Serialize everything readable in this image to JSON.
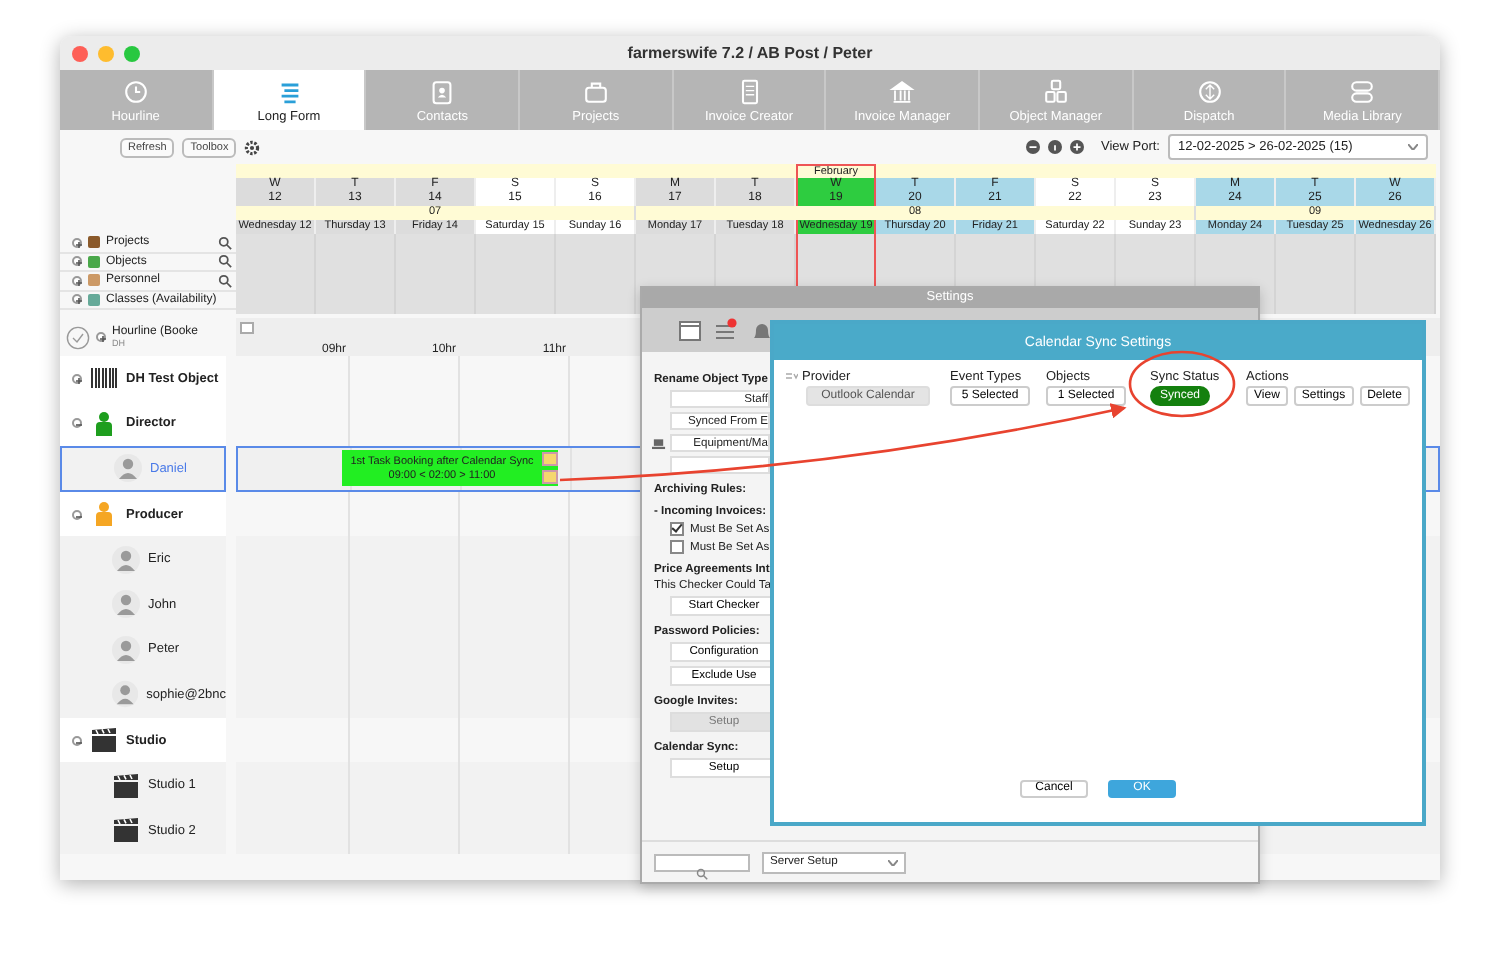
{
  "window": {
    "title": "farmerswife 7.2  / AB Post / Peter"
  },
  "tabs": [
    {
      "label": "Hourline",
      "selected": false
    },
    {
      "label": "Long Form",
      "selected": true
    },
    {
      "label": "Contacts",
      "selected": false
    },
    {
      "label": "Projects",
      "selected": false
    },
    {
      "label": "Invoice Creator",
      "selected": false
    },
    {
      "label": "Invoice Manager",
      "selected": false
    },
    {
      "label": "Object Manager",
      "selected": false
    },
    {
      "label": "Dispatch",
      "selected": false
    },
    {
      "label": "Media Library",
      "selected": false
    }
  ],
  "toolbar": {
    "refresh": "Refresh",
    "toolbox": "Toolbox",
    "view_port_label": "View Port:",
    "view_port": "12-02-2025 > 26-02-2025 (15)"
  },
  "calendar": {
    "days": [
      {
        "letter": "W",
        "number": "12",
        "name": "Wednesday 12",
        "kind": "past",
        "week": "07"
      },
      {
        "letter": "T",
        "number": "13",
        "name": "Thursday 13",
        "kind": "past"
      },
      {
        "letter": "F",
        "number": "14",
        "name": "Friday 14",
        "kind": "past"
      },
      {
        "letter": "S",
        "number": "15",
        "name": "Saturday 15",
        "kind": "weekend"
      },
      {
        "letter": "S",
        "number": "16",
        "name": "Sunday 16",
        "kind": "weekend"
      },
      {
        "letter": "M",
        "number": "17",
        "name": "Monday 17",
        "kind": "past",
        "week": "08"
      },
      {
        "letter": "T",
        "number": "18",
        "name": "Tuesday 18",
        "kind": "past"
      },
      {
        "letter": "W",
        "number": "19",
        "name": "Wednesday 19",
        "kind": "today",
        "month": "February"
      },
      {
        "letter": "T",
        "number": "20",
        "name": "Thursday 20",
        "kind": "future"
      },
      {
        "letter": "F",
        "number": "21",
        "name": "Friday 21",
        "kind": "future"
      },
      {
        "letter": "S",
        "number": "22",
        "name": "Saturday 22",
        "kind": "weekend"
      },
      {
        "letter": "S",
        "number": "23",
        "name": "Sunday 23",
        "kind": "weekend"
      },
      {
        "letter": "M",
        "number": "24",
        "name": "Monday 24",
        "kind": "future",
        "week": "09"
      },
      {
        "letter": "T",
        "number": "25",
        "name": "Tuesday 25",
        "kind": "future"
      },
      {
        "letter": "W",
        "number": "26",
        "name": "Wednesday 26",
        "kind": "future"
      }
    ]
  },
  "tree": [
    {
      "label": "Projects",
      "searchable": true
    },
    {
      "label": "Objects",
      "searchable": true
    },
    {
      "label": "Personnel",
      "searchable": true
    },
    {
      "label": "Classes (Availability)",
      "searchable": false
    }
  ],
  "hourline": {
    "label": "Hourline (Booke",
    "sub": "DH",
    "hours": [
      "09hr",
      "10hr",
      "11hr"
    ]
  },
  "resources": [
    {
      "name": "DH Test Object",
      "kind": "objects",
      "expanded": false,
      "selected": false
    },
    {
      "name": "Director",
      "kind": "role",
      "color": "#1e9e1e",
      "expanded": true,
      "selected": false
    },
    {
      "name": "Daniel",
      "kind": "person",
      "selected": true
    },
    {
      "name": "Producer",
      "kind": "role",
      "color": "#f5a623",
      "expanded": true,
      "selected": false
    },
    {
      "name": "Eric",
      "kind": "person",
      "selected": false
    },
    {
      "name": "John",
      "kind": "person",
      "selected": false
    },
    {
      "name": "Peter",
      "kind": "person",
      "selected": false
    },
    {
      "name": "sophie@2bnc",
      "kind": "person",
      "selected": false
    },
    {
      "name": "Studio",
      "kind": "studios",
      "expanded": true,
      "selected": false
    },
    {
      "name": "Studio 1",
      "kind": "studio",
      "selected": false
    },
    {
      "name": "Studio 2",
      "kind": "studio",
      "selected": false
    }
  ],
  "booking": {
    "title": "1st Task Booking after Calendar Sync",
    "time": "09:00 < 02:00 > 11:00"
  },
  "settings": {
    "title": "Settings",
    "items": [
      {
        "kind": "heading",
        "text": "Rename Object Type"
      },
      {
        "kind": "field",
        "text": "Staff"
      },
      {
        "kind": "field",
        "text": "Synced From E"
      },
      {
        "kind": "field",
        "text": "Equipment/Ma",
        "icon": true
      },
      {
        "kind": "field"
      },
      {
        "kind": "heading",
        "text": "Archiving Rules:"
      },
      {
        "kind": "heading",
        "text": "- Incoming Invoices:"
      },
      {
        "kind": "checkbox",
        "text": "Must Be Set As",
        "checked": true
      },
      {
        "kind": "checkbox",
        "text": "Must Be Set As",
        "checked": false
      },
      {
        "kind": "heading",
        "text": "Price Agreements Int"
      },
      {
        "kind": "text",
        "text": "This Checker Could Ta"
      },
      {
        "kind": "button",
        "text": "Start Checker",
        "disabled": false
      },
      {
        "kind": "heading",
        "text": "Password Policies:"
      },
      {
        "kind": "button",
        "text": "Configuration",
        "disabled": false
      },
      {
        "kind": "button",
        "text": "Exclude Use",
        "disabled": false
      },
      {
        "kind": "heading",
        "text": "Google Invites:"
      },
      {
        "kind": "button",
        "text": "Setup",
        "disabled": true
      },
      {
        "kind": "heading",
        "text": "Calendar Sync:"
      },
      {
        "kind": "button",
        "text": "Setup",
        "disabled": false
      }
    ],
    "server_setup": "Server Setup"
  },
  "sync_dialog": {
    "title": "Calendar Sync Settings",
    "columns": [
      "Provider",
      "Event Types",
      "Objects",
      "Sync Status",
      "Actions"
    ],
    "row": {
      "provider": "Outlook Calendar",
      "event_types": "5 Selected",
      "objects": "1 Selected",
      "status": "Synced",
      "actions": [
        "View",
        "Settings",
        "Delete"
      ]
    },
    "buttons": [
      {
        "label": "Cancel",
        "kind": "secondary"
      },
      {
        "label": "OK",
        "kind": "primary"
      }
    ]
  }
}
